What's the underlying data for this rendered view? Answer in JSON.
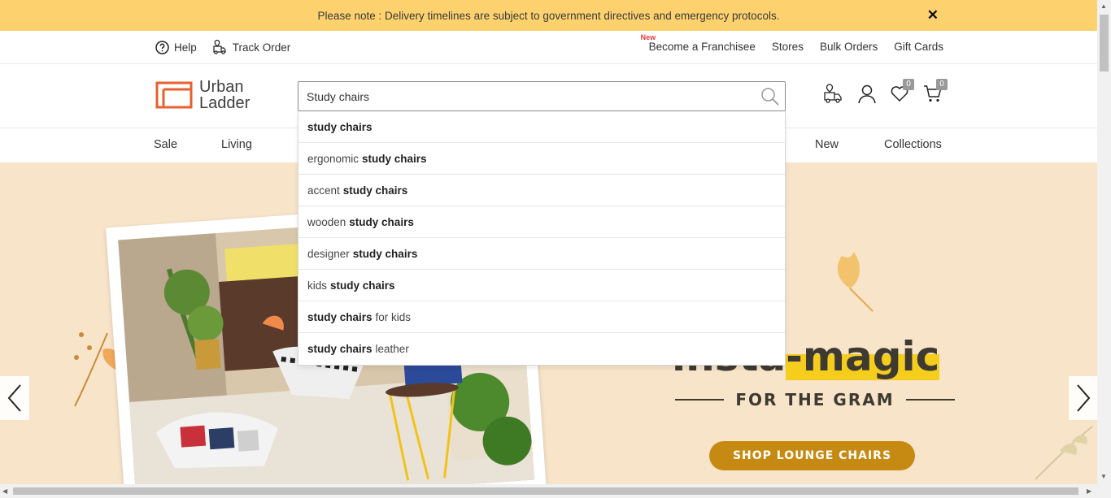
{
  "notice": {
    "text": "Please note : Delivery timelines are subject to government directives and emergency protocols.",
    "close": "✕"
  },
  "util": {
    "help": "Help",
    "track_order": "Track Order",
    "new_tag": "New",
    "franchise": "Become a Franchisee",
    "stores": "Stores",
    "bulk_orders": "Bulk Orders",
    "gift_cards": "Gift Cards"
  },
  "logo": {
    "line1": "Urban",
    "line2": "Ladder"
  },
  "search": {
    "value": "Study chairs"
  },
  "header": {
    "wishlist_count": "0",
    "cart_count": "0"
  },
  "nav": {
    "items": [
      "Sale",
      "Living",
      "New",
      "Collections"
    ]
  },
  "suggestions": [
    {
      "pre": "",
      "bold": "study chairs",
      "post": ""
    },
    {
      "pre": "ergonomic",
      "bold": "study chairs",
      "post": ""
    },
    {
      "pre": "accent",
      "bold": "study chairs",
      "post": ""
    },
    {
      "pre": "wooden",
      "bold": "study chairs",
      "post": ""
    },
    {
      "pre": "designer",
      "bold": "study chairs",
      "post": ""
    },
    {
      "pre": "kids",
      "bold": "study chairs",
      "post": ""
    },
    {
      "pre": "",
      "bold": "study chairs",
      "post": "for kids"
    },
    {
      "pre": "",
      "bold": "study chairs",
      "post": "leather"
    }
  ],
  "hero": {
    "title_a": "insta",
    "title_b": "-magic",
    "subtitle": "FOR THE GRAM",
    "button": "SHOP LOUNGE CHAIRS"
  },
  "colors": {
    "notice_bg": "#fdd26e",
    "logo_orange": "#e8612c",
    "hero_bg": "#f7e4c9",
    "button": "#c68a13",
    "highlight": "#f5cd1d"
  }
}
